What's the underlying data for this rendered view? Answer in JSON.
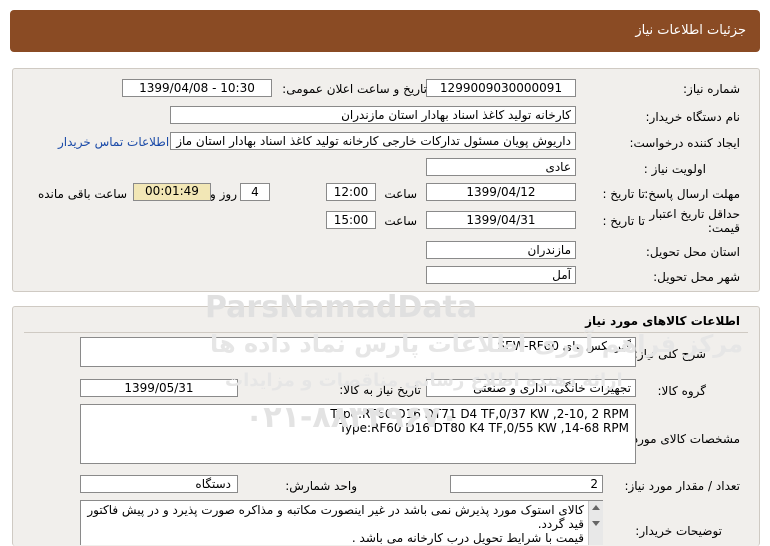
{
  "header": {
    "title": "جزئیات اطلاعات نیاز"
  },
  "need": {
    "number_label": "شماره نیاز:",
    "number": "1299009030000091",
    "announce_label": "تاریخ و ساعت اعلان عمومی:",
    "announce": "1399/04/08 - 10:30",
    "buyer_org_label": "نام دستگاه خریدار:",
    "buyer_org": "کارخانه تولید کاغذ اسناد بهادار استان مازندران",
    "creator_label": "ایجاد کننده درخواست:",
    "creator": "داریوش  پویان مسئول تدارکات خارجی کارخانه تولید کاغذ اسناد بهادار استان ماز",
    "contact_link": "اطلاعات تماس خریدار",
    "priority_label": "اولویت نیاز :",
    "priority": "عادی",
    "deadline_label": "مهلت ارسال پاسخ:",
    "to_date_label": "تا تاریخ :",
    "deadline_date": "1399/04/12",
    "time_label": "ساعت",
    "deadline_time": "12:00",
    "days": "4",
    "day_and_label": "روز و",
    "remaining": "00:01:49",
    "remaining_label": "ساعت باقی مانده",
    "validity_label": "حداقل تاریخ اعتبار قیمت:",
    "validity_date": "1399/04/31",
    "validity_time": "15:00",
    "province_label": "استان محل تحویل:",
    "province": "مازندران",
    "city_label": "شهر محل تحویل:",
    "city": "آمل"
  },
  "goods": {
    "title": "اطلاعات کالاهای مورد نیاز",
    "summary_label": "شرح کلی نیاز:",
    "summary": "گیر بکس های SEW-RF60",
    "group_label": "گروه کالا:",
    "group": "تجهیزات خانگی، اداری و صنعتی",
    "need_date_label": "تاریخ نیاز به کالا:",
    "need_date": "1399/05/31",
    "specs_label": "مشخصات کالای مورد نیاز:",
    "spec_line1": "Type:RF60 D16 DT71 D4 TF,0/37 KW ,2-10, 2 RPM",
    "spec_line2": "Type:RF60 D16 DT80 K4 TF,0/55 KW ,14-68 RPM",
    "qty_label": "تعداد / مقدار مورد نیاز:",
    "qty": "2",
    "unit_label": "واحد شمارش:",
    "unit": "دستگاه",
    "buyer_notes_label": "توضیحات خریدار:",
    "note_line1": "کالای استوک مورد پذیرش نمی باشد در غیر اینصورت مکاتبه و مذاکره صورت پذیرد و در پیش فاکتور",
    "note_line2": "قید گردد.",
    "note_line3": "قیمت با  شرایط تحویل درب کارخانه می باشد ."
  },
  "watermark": {
    "brand": "ParsNamadData",
    "fa_line1": "مرکز فراهم آوری اطلاعات پارس نماد داده ها",
    "fa_line2": "ارائه دهنده اطلاع رسانی مناقصات و مزایدات",
    "phone": "۰۲۱-۸۸۳۴۹۶۷۰"
  }
}
